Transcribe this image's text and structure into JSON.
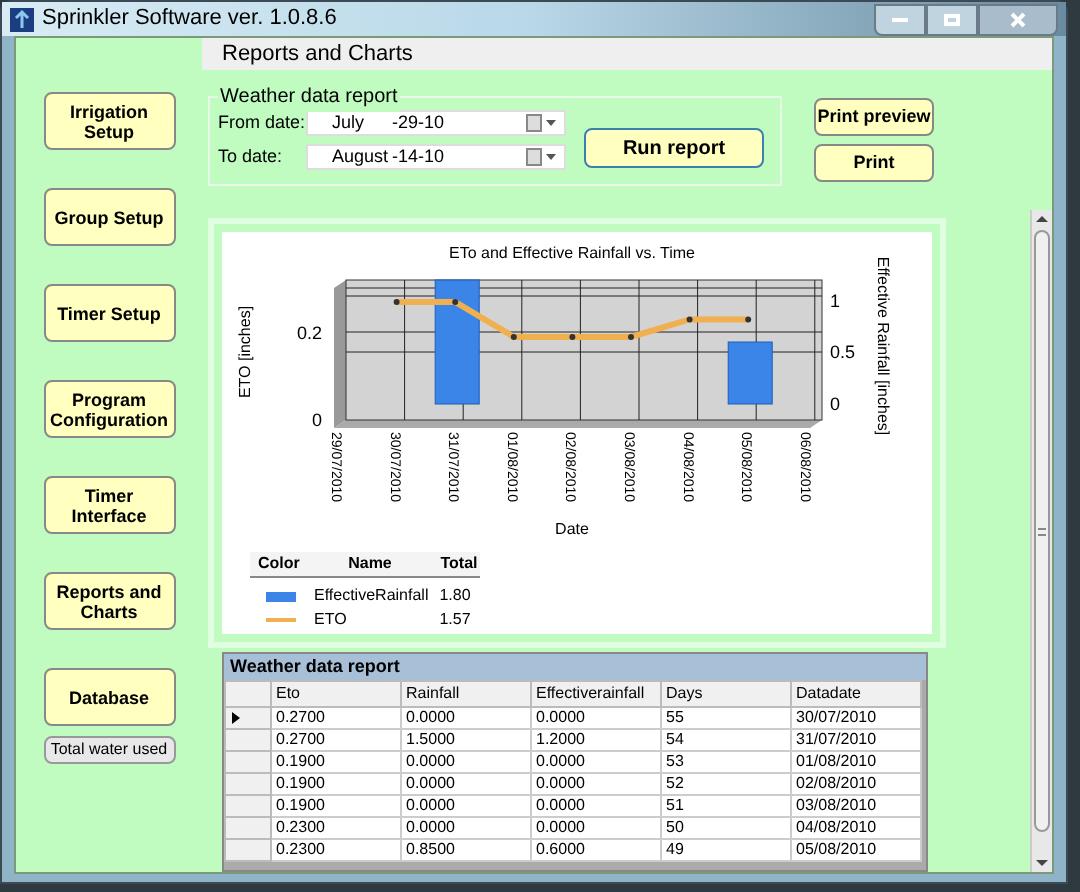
{
  "window": {
    "title": "Sprinkler Software ver. 1.0.8.6"
  },
  "header": {
    "title": "Reports and Charts"
  },
  "nav": [
    {
      "label": "Irrigation Setup",
      "kind": "main"
    },
    {
      "label": "Group Setup",
      "kind": "main"
    },
    {
      "label": "Timer Setup",
      "kind": "main"
    },
    {
      "label": "Program Configuration",
      "kind": "main"
    },
    {
      "label": "Timer Interface",
      "kind": "main"
    },
    {
      "label": "Reports and Charts",
      "kind": "main"
    },
    {
      "label": "Database",
      "kind": "main"
    },
    {
      "label": "Total water used",
      "kind": "small"
    }
  ],
  "report_form": {
    "title": "Weather data report",
    "fields": [
      {
        "label": "From date:",
        "month": "July",
        "value": "-29-10"
      },
      {
        "label": "To date:",
        "month": "August",
        "value": "-14-10"
      }
    ],
    "run_button": "Run report"
  },
  "print_buttons": [
    "Print preview",
    "Print"
  ],
  "chart": {
    "chart_data": {
      "type": "bar",
      "title": "ETo and Effective Rainfall vs. Time",
      "xlabel": "Date",
      "ylabel": "ETO [inches]",
      "y2label": "Effective Rainfall [inches]",
      "categories": [
        "29/07/2010",
        "30/07/2010",
        "31/07/2010",
        "01/08/2010",
        "02/08/2010",
        "03/08/2010",
        "04/08/2010",
        "05/08/2010",
        "06/08/2010"
      ],
      "series": [
        {
          "name": "EffectiveRainfall",
          "type": "bar",
          "axis": "y2",
          "color": "#3b84e8",
          "values": [
            null,
            0,
            1.2,
            0,
            0,
            0,
            0,
            0.6,
            null
          ]
        },
        {
          "name": "ETO",
          "type": "line",
          "color": "#f0b050",
          "marker": "o",
          "values": [
            null,
            0.27,
            0.27,
            0.19,
            0.19,
            0.19,
            0.23,
            0.23,
            null
          ]
        }
      ],
      "grid": true,
      "legend": "bottom left",
      "ylim": [
        0,
        0.32
      ],
      "yticks": [
        0,
        0.2
      ],
      "y2lim": [
        0,
        1.2
      ],
      "y2ticks": [
        0,
        0.5,
        1
      ]
    },
    "legend": {
      "columns": [
        "Color",
        "Name",
        "Total"
      ],
      "rows": [
        {
          "total": "1.80"
        },
        {
          "total": "1.57"
        }
      ]
    }
  },
  "grid": {
    "title": "Weather data report",
    "columns": [
      "Eto",
      "Rainfall",
      "Effectiverainfall",
      "Days",
      "Datadate"
    ],
    "rows": [
      {
        "selected": true,
        "cells": [
          "0.2700",
          "0.0000",
          "0.0000",
          "55",
          "30/07/2010"
        ]
      },
      {
        "selected": false,
        "cells": [
          "0.2700",
          "1.5000",
          "1.2000",
          "54",
          "31/07/2010"
        ]
      },
      {
        "selected": false,
        "cells": [
          "0.1900",
          "0.0000",
          "0.0000",
          "53",
          "01/08/2010"
        ]
      },
      {
        "selected": false,
        "cells": [
          "0.1900",
          "0.0000",
          "0.0000",
          "52",
          "02/08/2010"
        ]
      },
      {
        "selected": false,
        "cells": [
          "0.1900",
          "0.0000",
          "0.0000",
          "51",
          "03/08/2010"
        ]
      },
      {
        "selected": false,
        "cells": [
          "0.2300",
          "0.0000",
          "0.0000",
          "50",
          "04/08/2010"
        ]
      },
      {
        "selected": false,
        "cells": [
          "0.2300",
          "0.8500",
          "0.6000",
          "49",
          "05/08/2010"
        ]
      }
    ]
  }
}
